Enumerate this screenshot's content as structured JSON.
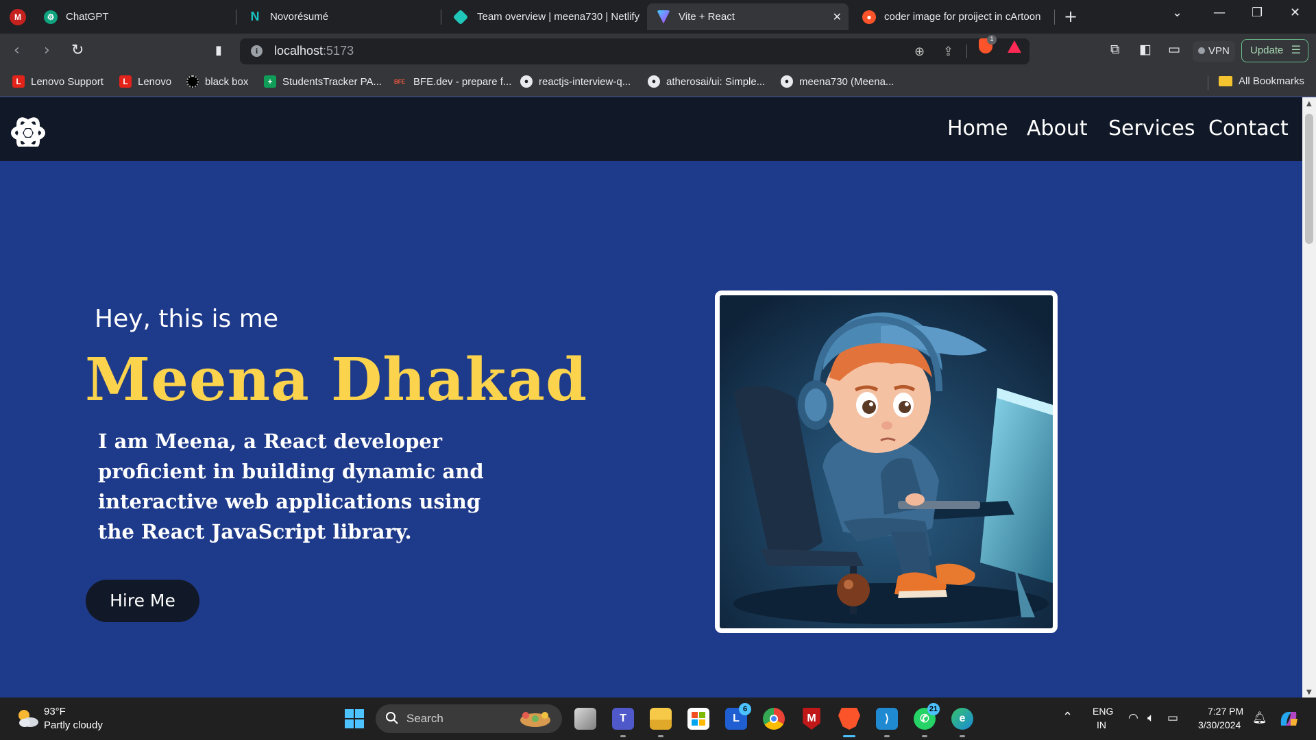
{
  "browser": {
    "tabs": [
      {
        "title": "ChatGPT",
        "icon": "chatgpt-icon"
      },
      {
        "title": "Novorésumé",
        "icon": "novoresume-icon"
      },
      {
        "title": "Team overview | meena730 | Netlify",
        "icon": "netlify-icon"
      },
      {
        "title": "Vite + React",
        "icon": "vite-icon",
        "active": true
      },
      {
        "title": "coder image for proiject in cArtoon",
        "icon": "brave-icon"
      }
    ],
    "url": {
      "host": "localhost",
      "port": ":5173"
    },
    "shield_count": "1",
    "vpn_label": "VPN",
    "update_label": "Update",
    "bookmarks": [
      {
        "label": "Lenovo Support",
        "icon": "lenovo-icon",
        "glyph": "L"
      },
      {
        "label": "Lenovo",
        "icon": "lenovo-icon",
        "glyph": "L"
      },
      {
        "label": "black box",
        "icon": "blackbox-icon",
        "glyph": ""
      },
      {
        "label": "StudentsTracker PA...",
        "icon": "sheets-icon",
        "glyph": "+"
      },
      {
        "label": "BFE.dev - prepare f...",
        "icon": "bfe-icon",
        "glyph": "BFE"
      },
      {
        "label": "reactjs-interview-q...",
        "icon": "github-icon",
        "glyph": ""
      },
      {
        "label": "atherosai/ui: Simple...",
        "icon": "github-icon",
        "glyph": ""
      },
      {
        "label": "meena730 (Meena...",
        "icon": "github-icon",
        "glyph": ""
      }
    ],
    "all_bookmarks_label": "All Bookmarks"
  },
  "site": {
    "nav": [
      "Home",
      "About",
      "Services",
      "Contact"
    ],
    "intro": "Hey, this is me",
    "name": "Meena Dhakad",
    "bio": "I am Meena, a React developer proficient in building dynamic and interactive web applications using the React JavaScript library.",
    "cta": "Hire Me",
    "accent_color": "#fcd34d",
    "background_color": "#1e3a8a",
    "nav_background": "#111827"
  },
  "taskbar": {
    "weather": {
      "temp": "93°F",
      "desc": "Partly cloudy"
    },
    "search_label": "Search",
    "apps": [
      {
        "name": "task-view",
        "badge": ""
      },
      {
        "name": "teams",
        "badge": ""
      },
      {
        "name": "file-explorer",
        "badge": ""
      },
      {
        "name": "microsoft-store",
        "badge": ""
      },
      {
        "name": "lenovo-app",
        "badge": "6"
      },
      {
        "name": "chrome",
        "badge": ""
      },
      {
        "name": "mcafee",
        "badge": ""
      },
      {
        "name": "brave",
        "badge": ""
      },
      {
        "name": "vscode",
        "badge": ""
      },
      {
        "name": "whatsapp",
        "badge": "21"
      },
      {
        "name": "edge",
        "badge": ""
      }
    ],
    "lang_top": "ENG",
    "lang_bottom": "IN",
    "time": "7:27 PM",
    "date": "3/30/2024"
  }
}
